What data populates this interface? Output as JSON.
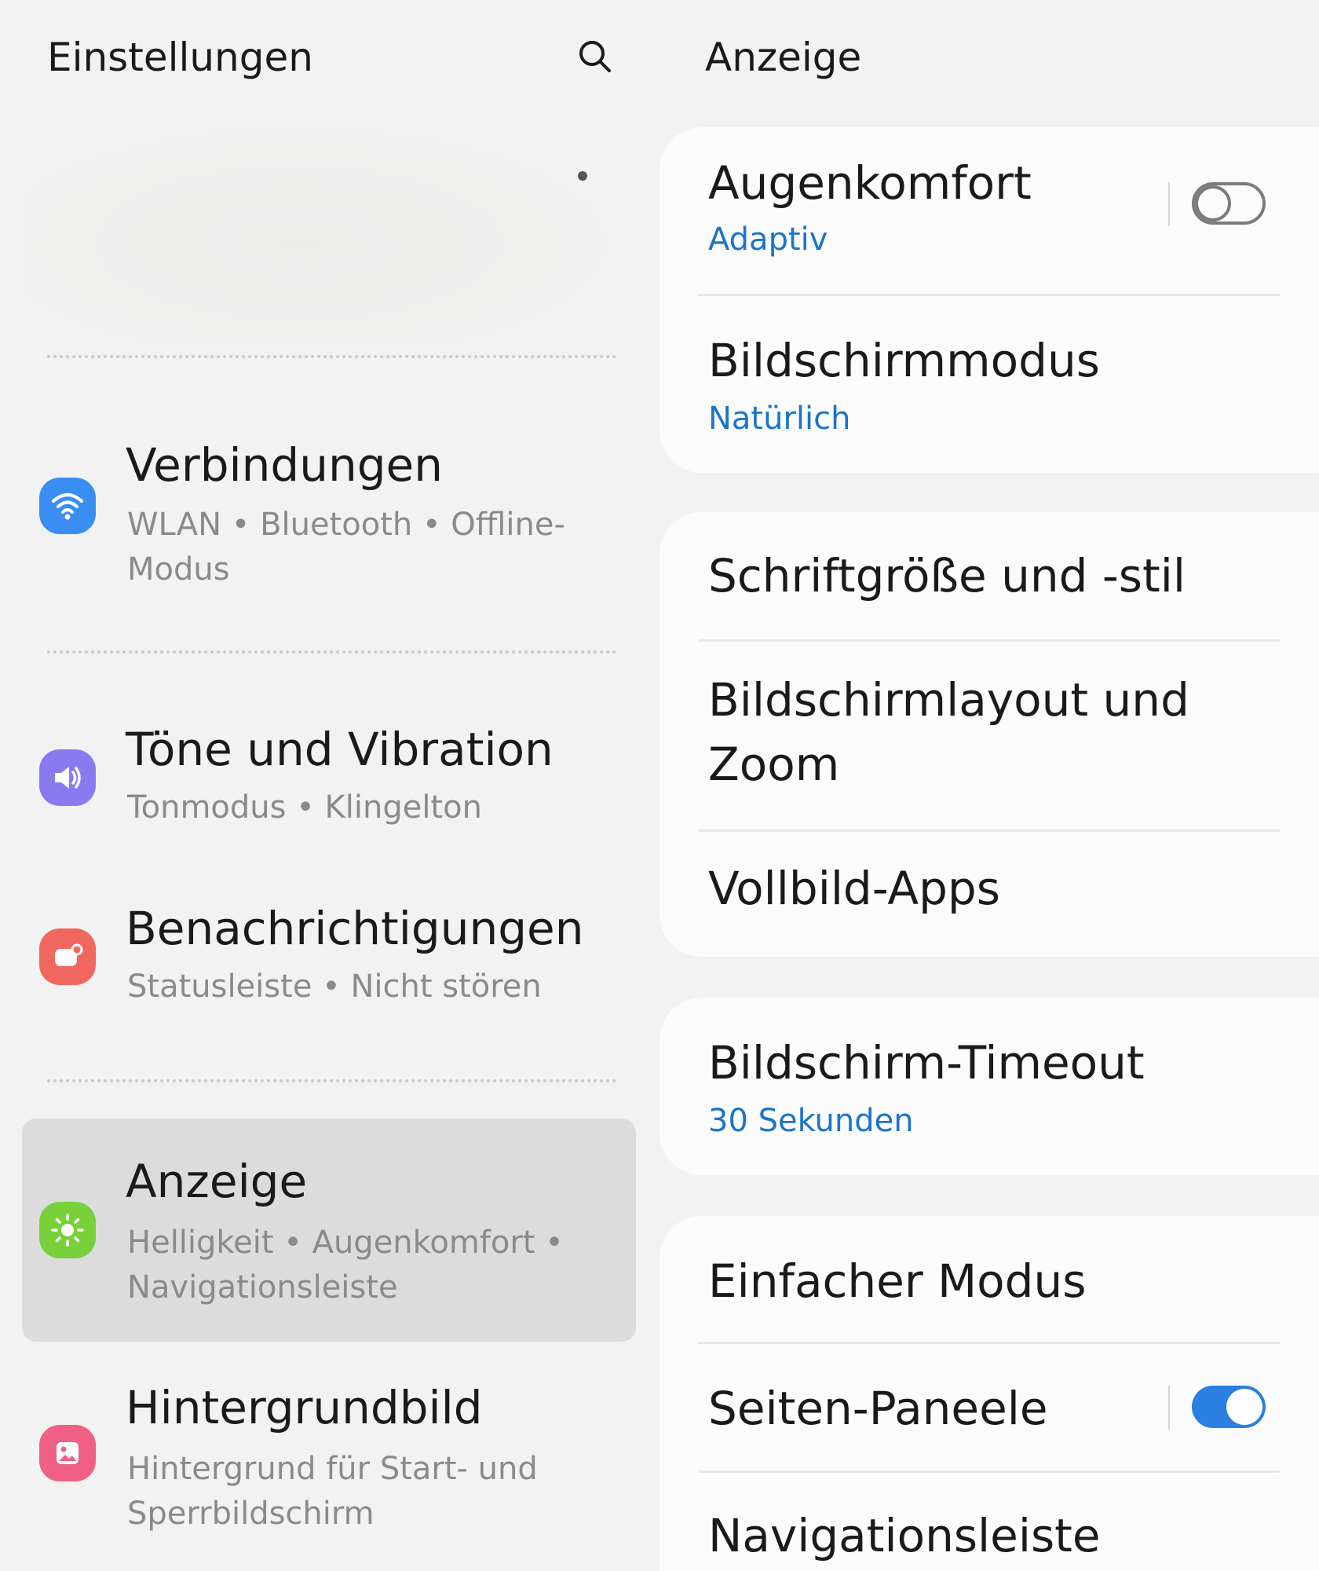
{
  "left": {
    "title": "Einstellungen",
    "search_icon": "search-icon",
    "items": [
      {
        "title": "Verbindungen",
        "subtitle": "WLAN  •  Bluetooth  •  Offline-Modus",
        "icon": "wifi-icon",
        "color": "#3a8ef2"
      },
      {
        "title": "Töne und Vibration",
        "subtitle": "Tonmodus  •  Klingelton",
        "icon": "speaker-icon",
        "color": "#8a7af0"
      },
      {
        "title": "Benachrichtigungen",
        "subtitle": "Statusleiste  •  Nicht stören",
        "icon": "notification-icon",
        "color": "#f0675d"
      },
      {
        "title": "Anzeige",
        "subtitle": "Helligkeit  •  Augenkomfort  •  Navigationsleiste",
        "icon": "brightness-icon",
        "color": "#78d03a",
        "active": true
      },
      {
        "title": "Hintergrundbild",
        "subtitle": "Hintergrund für Start- und Sperrbildschirm",
        "icon": "wallpaper-icon",
        "color": "#ef5f86"
      }
    ]
  },
  "right": {
    "title": "Anzeige",
    "groups": [
      {
        "rows": [
          {
            "title": "Augenkomfort",
            "subtitle": "Adaptiv",
            "toggle": "off"
          },
          {
            "title": "Bildschirmmodus",
            "subtitle": "Natürlich"
          }
        ]
      },
      {
        "rows": [
          {
            "title": "Schriftgröße und -stil"
          },
          {
            "title": "Bildschirmlayout und Zoom"
          },
          {
            "title": "Vollbild-Apps"
          }
        ]
      },
      {
        "rows": [
          {
            "title": "Bildschirm-Timeout",
            "subtitle": "30 Sekunden"
          }
        ]
      },
      {
        "rows": [
          {
            "title": "Einfacher Modus"
          },
          {
            "title": "Seiten-Paneele",
            "toggle": "on"
          },
          {
            "title": "Navigationsleiste"
          }
        ]
      }
    ]
  },
  "colors": {
    "accent_blue": "#1a75c9",
    "toggle_on": "#2a7fe0",
    "selected_bg": "#dcdcdc",
    "background": "#f2f2f2"
  }
}
